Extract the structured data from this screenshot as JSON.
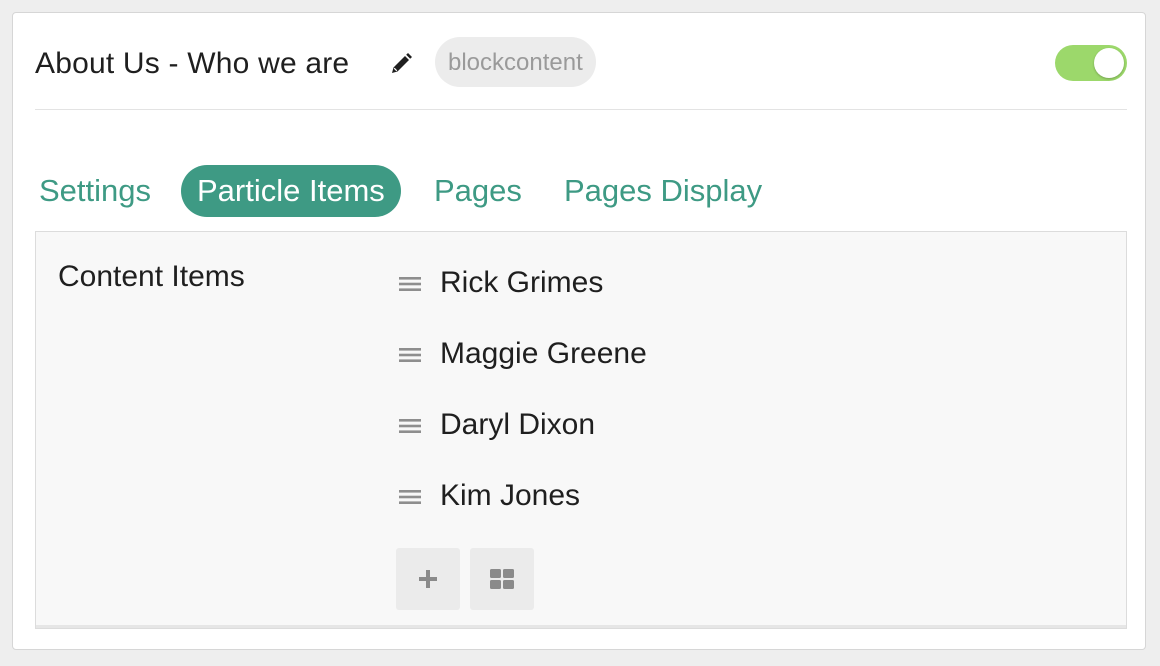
{
  "header": {
    "title": "About Us - Who we are",
    "badge": "blockcontent",
    "edit_icon": "pencil-icon",
    "enabled": true,
    "toggle_color": "#9cd86b"
  },
  "tabs": [
    {
      "label": "Settings",
      "active": false
    },
    {
      "label": "Particle Items",
      "active": true
    },
    {
      "label": "Pages",
      "active": false
    },
    {
      "label": "Pages Display",
      "active": false
    }
  ],
  "accent_color": "#3e9a84",
  "content": {
    "label": "Content Items",
    "items": [
      {
        "label": "Rick Grimes",
        "icon": "drag-handle-icon"
      },
      {
        "label": "Maggie Greene",
        "icon": "drag-handle-icon"
      },
      {
        "label": "Daryl Dixon",
        "icon": "drag-handle-icon"
      },
      {
        "label": "Kim Jones",
        "icon": "drag-handle-icon"
      }
    ],
    "buttons": [
      {
        "icon": "plus-icon"
      },
      {
        "icon": "grid-icon"
      }
    ]
  }
}
